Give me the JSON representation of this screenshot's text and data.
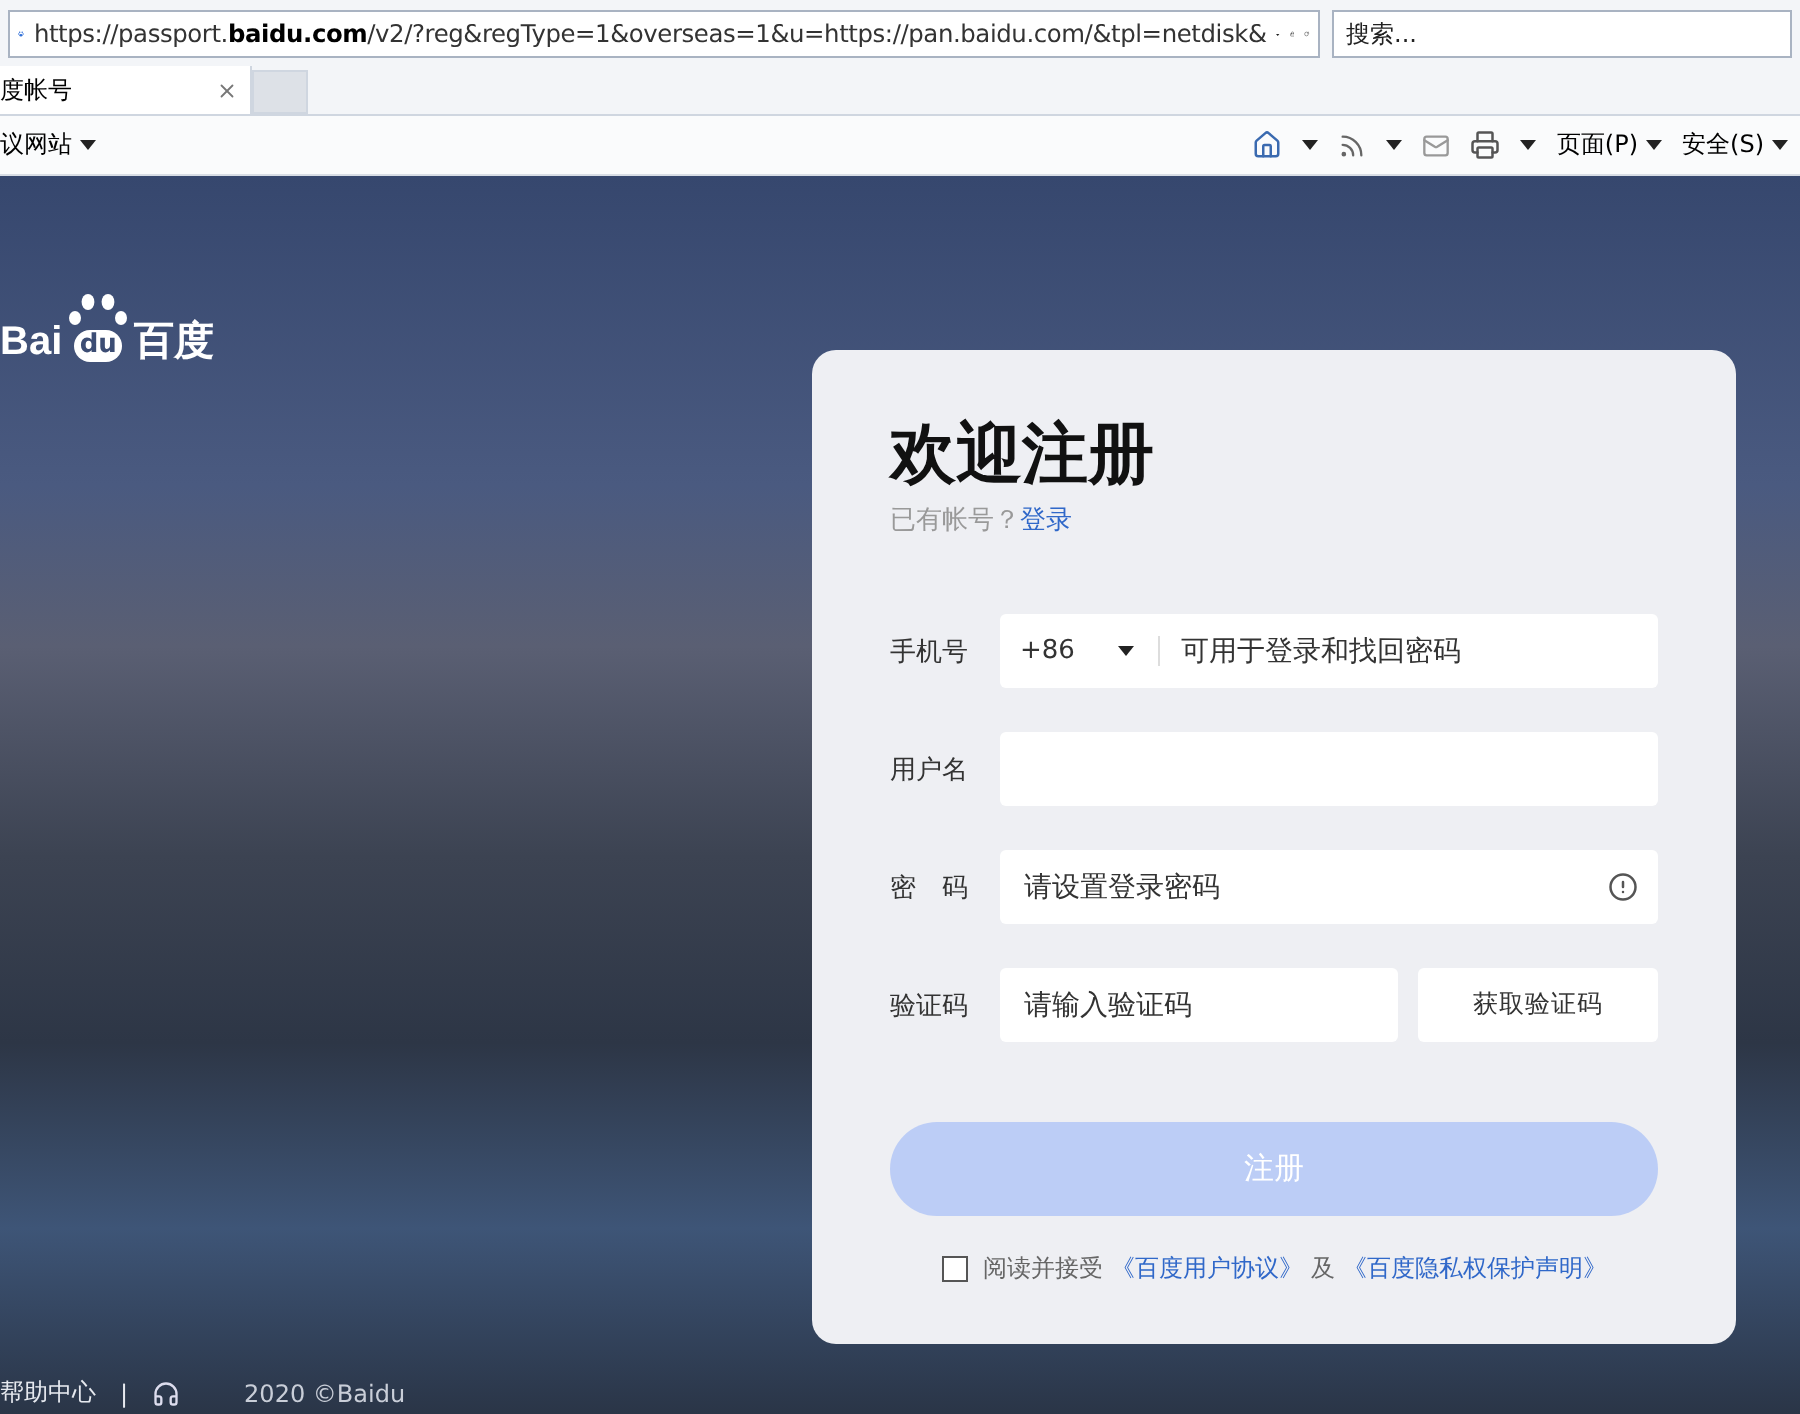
{
  "browser": {
    "address": "https://passport.**baidu.com**/v2/?reg&regType=1&overseas=1&u=https://pan.baidu.com/&tpl=netdisk&",
    "search_placeholder": "搜索...",
    "tabs": [
      {
        "title": "度帐号",
        "selected": true
      }
    ],
    "favorites": "议网站",
    "commands": [
      "页面(P)",
      "安全(S)"
    ]
  },
  "logo": {
    "latin": "Bai",
    "paw": "du",
    "chinese": "百度"
  },
  "form": {
    "title": "欢迎注册",
    "account_prompt": "已有帐号？",
    "login_link": "登录",
    "fields": [
      {
        "kind": "phone",
        "label": "手机号",
        "country_code": "+86",
        "placeholder": "可用于登录和找回密码"
      },
      {
        "kind": "text",
        "label": "用户名"
      },
      {
        "kind": "password",
        "label": "密　码",
        "placeholder": "请设置登录密码"
      },
      {
        "kind": "code",
        "label": "验证码",
        "placeholder": "请输入验证码",
        "button": "获取验证码"
      }
    ],
    "submit": {
      "label": "注册",
      "disabled": true
    },
    "agreement": {
      "checked": false,
      "text": "阅读并接受",
      "link_1": "《百度用户协议》",
      "joiner": "及",
      "link_2": "《百度隐私权保护声明》"
    }
  },
  "footer": {
    "help": "帮助中心",
    "separator": "|",
    "copyright": "2020 ©Baidu"
  }
}
